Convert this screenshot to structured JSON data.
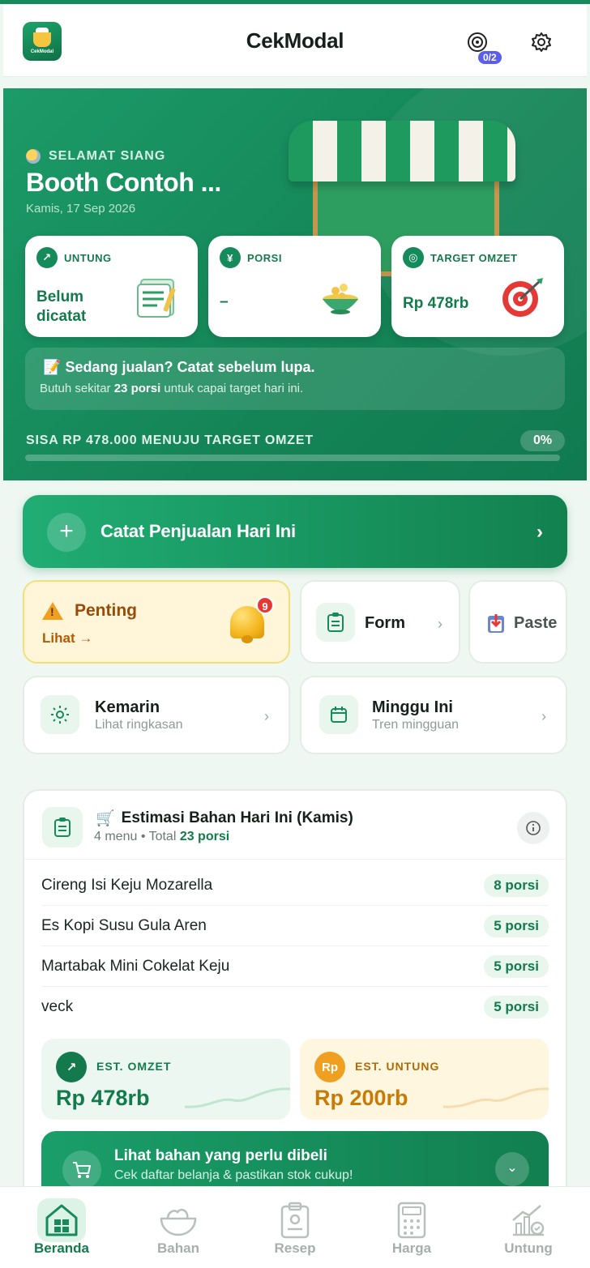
{
  "header": {
    "logo_text": "CekModal",
    "title": "CekModal",
    "target_badge": "0/2",
    "icons": [
      "target-icon",
      "gear-icon"
    ]
  },
  "hero": {
    "greeting": "SELAMAT SIANG",
    "booth_name": "Booth Contoh ...",
    "date": "Kamis, 17 Sep 2026",
    "stats": [
      {
        "label": "UNTUNG",
        "value": "Belum dicatat",
        "icon": "trend-up-icon"
      },
      {
        "label": "PORSI",
        "value": "–",
        "icon": "utensils-icon"
      },
      {
        "label": "TARGET OMZET",
        "value": "Rp 478rb",
        "icon": "target-icon"
      }
    ],
    "tip_title": "Sedang jualan? Catat sebelum lupa.",
    "tip_sub_pre": "Butuh sekitar ",
    "tip_sub_bold": "23 porsi",
    "tip_sub_post": " untuk capai target hari ini.",
    "progress_label": "SISA RP 478.000 MENUJU TARGET OMZET",
    "progress_pct": "0%",
    "progress_value": 0
  },
  "cta": {
    "label": "Catat Penjualan Hari Ini"
  },
  "tiles": {
    "penting": {
      "title": "Penting",
      "link": "Lihat →",
      "badge": "9"
    },
    "form": {
      "title": "Form"
    },
    "paste": {
      "title": "Paste"
    },
    "kemarin": {
      "title": "Kemarin",
      "sub": "Lihat ringkasan"
    },
    "minggu": {
      "title": "Minggu Ini",
      "sub": "Tren mingguan"
    }
  },
  "estimasi": {
    "title": "Estimasi Bahan Hari Ini (Kamis)",
    "sub_pre": "4 menu • Total ",
    "sub_bold": "23 porsi",
    "menus": [
      {
        "name": "Cireng Isi Keju Mozarella",
        "qty": "8 porsi"
      },
      {
        "name": "Es Kopi Susu Gula Aren",
        "qty": "5 porsi"
      },
      {
        "name": "Martabak Mini Cokelat Keju",
        "qty": "5 porsi"
      },
      {
        "name": "veck",
        "qty": "5 porsi"
      }
    ],
    "omzet": {
      "label": "EST. OMZET",
      "value": "Rp 478rb"
    },
    "untung": {
      "label": "EST. UNTUNG",
      "value": "Rp 200rb",
      "icon_text": "Rp"
    },
    "shop_title": "Lihat bahan yang perlu dibeli",
    "shop_sub": "Cek daftar belanja & pastikan stok cukup!"
  },
  "nav": [
    {
      "label": "Beranda",
      "active": true
    },
    {
      "label": "Bahan",
      "active": false
    },
    {
      "label": "Resep",
      "active": false
    },
    {
      "label": "Harga",
      "active": false
    },
    {
      "label": "Untung",
      "active": false
    }
  ],
  "colors": {
    "primary": "#158a5a",
    "warning_bg": "#fff6da",
    "badge": "#5b5ee8",
    "alert": "#e53935",
    "accent_orange": "#f0a020"
  }
}
